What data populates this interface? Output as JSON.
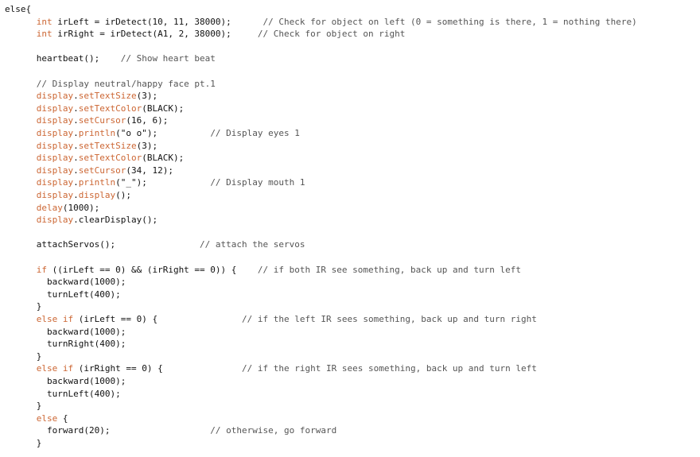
{
  "editor": {
    "colors": {
      "keyword": "#cc6633",
      "library": "#cc6633",
      "comment": "#555555",
      "text": "#111111",
      "background": "#ffffff"
    },
    "lines": [
      [
        {
          "t": "pl",
          "v": "else{"
        }
      ],
      [
        {
          "t": "pl",
          "v": "      "
        },
        {
          "t": "kw",
          "v": "int"
        },
        {
          "t": "pl",
          "v": " irLeft = irDetect(10, 11, 38000);      "
        },
        {
          "t": "cm",
          "v": "// Check for object on left (0 = something is there, 1 = nothing there)"
        }
      ],
      [
        {
          "t": "pl",
          "v": "      "
        },
        {
          "t": "kw",
          "v": "int"
        },
        {
          "t": "pl",
          "v": " irRight = irDetect(A1, 2, 38000);     "
        },
        {
          "t": "cm",
          "v": "// Check for object on right"
        }
      ],
      [],
      [
        {
          "t": "pl",
          "v": "      heartbeat();    "
        },
        {
          "t": "cm",
          "v": "// Show heart beat"
        }
      ],
      [],
      [
        {
          "t": "pl",
          "v": "      "
        },
        {
          "t": "cm",
          "v": "// Display neutral/happy face pt.1"
        }
      ],
      [
        {
          "t": "pl",
          "v": "      "
        },
        {
          "t": "obj",
          "v": "display"
        },
        {
          "t": "pl",
          "v": "."
        },
        {
          "t": "obj",
          "v": "setTextSize"
        },
        {
          "t": "pl",
          "v": "(3);"
        }
      ],
      [
        {
          "t": "pl",
          "v": "      "
        },
        {
          "t": "obj",
          "v": "display"
        },
        {
          "t": "pl",
          "v": "."
        },
        {
          "t": "obj",
          "v": "setTextColor"
        },
        {
          "t": "pl",
          "v": "(BLACK);"
        }
      ],
      [
        {
          "t": "pl",
          "v": "      "
        },
        {
          "t": "obj",
          "v": "display"
        },
        {
          "t": "pl",
          "v": "."
        },
        {
          "t": "obj",
          "v": "setCursor"
        },
        {
          "t": "pl",
          "v": "(16, 6);"
        }
      ],
      [
        {
          "t": "pl",
          "v": "      "
        },
        {
          "t": "obj",
          "v": "display"
        },
        {
          "t": "pl",
          "v": "."
        },
        {
          "t": "obj",
          "v": "println"
        },
        {
          "t": "pl",
          "v": "(\"o o\");          "
        },
        {
          "t": "cm",
          "v": "// Display eyes 1"
        }
      ],
      [
        {
          "t": "pl",
          "v": "      "
        },
        {
          "t": "obj",
          "v": "display"
        },
        {
          "t": "pl",
          "v": "."
        },
        {
          "t": "obj",
          "v": "setTextSize"
        },
        {
          "t": "pl",
          "v": "(3);"
        }
      ],
      [
        {
          "t": "pl",
          "v": "      "
        },
        {
          "t": "obj",
          "v": "display"
        },
        {
          "t": "pl",
          "v": "."
        },
        {
          "t": "obj",
          "v": "setTextColor"
        },
        {
          "t": "pl",
          "v": "(BLACK);"
        }
      ],
      [
        {
          "t": "pl",
          "v": "      "
        },
        {
          "t": "obj",
          "v": "display"
        },
        {
          "t": "pl",
          "v": "."
        },
        {
          "t": "obj",
          "v": "setCursor"
        },
        {
          "t": "pl",
          "v": "(34, 12);"
        }
      ],
      [
        {
          "t": "pl",
          "v": "      "
        },
        {
          "t": "obj",
          "v": "display"
        },
        {
          "t": "pl",
          "v": "."
        },
        {
          "t": "obj",
          "v": "println"
        },
        {
          "t": "pl",
          "v": "(\"_\");            "
        },
        {
          "t": "cm",
          "v": "// Display mouth 1"
        }
      ],
      [
        {
          "t": "pl",
          "v": "      "
        },
        {
          "t": "obj",
          "v": "display"
        },
        {
          "t": "pl",
          "v": "."
        },
        {
          "t": "obj",
          "v": "display"
        },
        {
          "t": "pl",
          "v": "();"
        }
      ],
      [
        {
          "t": "pl",
          "v": "      "
        },
        {
          "t": "obj",
          "v": "delay"
        },
        {
          "t": "pl",
          "v": "(1000);"
        }
      ],
      [
        {
          "t": "pl",
          "v": "      "
        },
        {
          "t": "obj",
          "v": "display"
        },
        {
          "t": "pl",
          "v": ".clearDisplay();"
        }
      ],
      [],
      [
        {
          "t": "pl",
          "v": "      attachServos();                "
        },
        {
          "t": "cm",
          "v": "// attach the servos"
        }
      ],
      [],
      [
        {
          "t": "pl",
          "v": "      "
        },
        {
          "t": "kw",
          "v": "if"
        },
        {
          "t": "pl",
          "v": " ((irLeft == 0) && (irRight == 0)) {    "
        },
        {
          "t": "cm",
          "v": "// if both IR see something, back up and turn left"
        }
      ],
      [
        {
          "t": "pl",
          "v": "        backward(1000);"
        }
      ],
      [
        {
          "t": "pl",
          "v": "        turnLeft(400);"
        }
      ],
      [
        {
          "t": "pl",
          "v": "      }"
        }
      ],
      [
        {
          "t": "pl",
          "v": "      "
        },
        {
          "t": "kw",
          "v": "else if"
        },
        {
          "t": "pl",
          "v": " (irLeft == 0) {                "
        },
        {
          "t": "cm",
          "v": "// if the left IR sees something, back up and turn right"
        }
      ],
      [
        {
          "t": "pl",
          "v": "        backward(1000);"
        }
      ],
      [
        {
          "t": "pl",
          "v": "        turnRight(400);"
        }
      ],
      [
        {
          "t": "pl",
          "v": "      }"
        }
      ],
      [
        {
          "t": "pl",
          "v": "      "
        },
        {
          "t": "kw",
          "v": "else if"
        },
        {
          "t": "pl",
          "v": " (irRight == 0) {               "
        },
        {
          "t": "cm",
          "v": "// if the right IR sees something, back up and turn left"
        }
      ],
      [
        {
          "t": "pl",
          "v": "        backward(1000);"
        }
      ],
      [
        {
          "t": "pl",
          "v": "        turnLeft(400);"
        }
      ],
      [
        {
          "t": "pl",
          "v": "      }"
        }
      ],
      [
        {
          "t": "pl",
          "v": "      "
        },
        {
          "t": "kw",
          "v": "else"
        },
        {
          "t": "pl",
          "v": " {"
        }
      ],
      [
        {
          "t": "pl",
          "v": "        forward(20);                   "
        },
        {
          "t": "cm",
          "v": "// otherwise, go forward"
        }
      ],
      [
        {
          "t": "pl",
          "v": "      }"
        }
      ]
    ]
  }
}
